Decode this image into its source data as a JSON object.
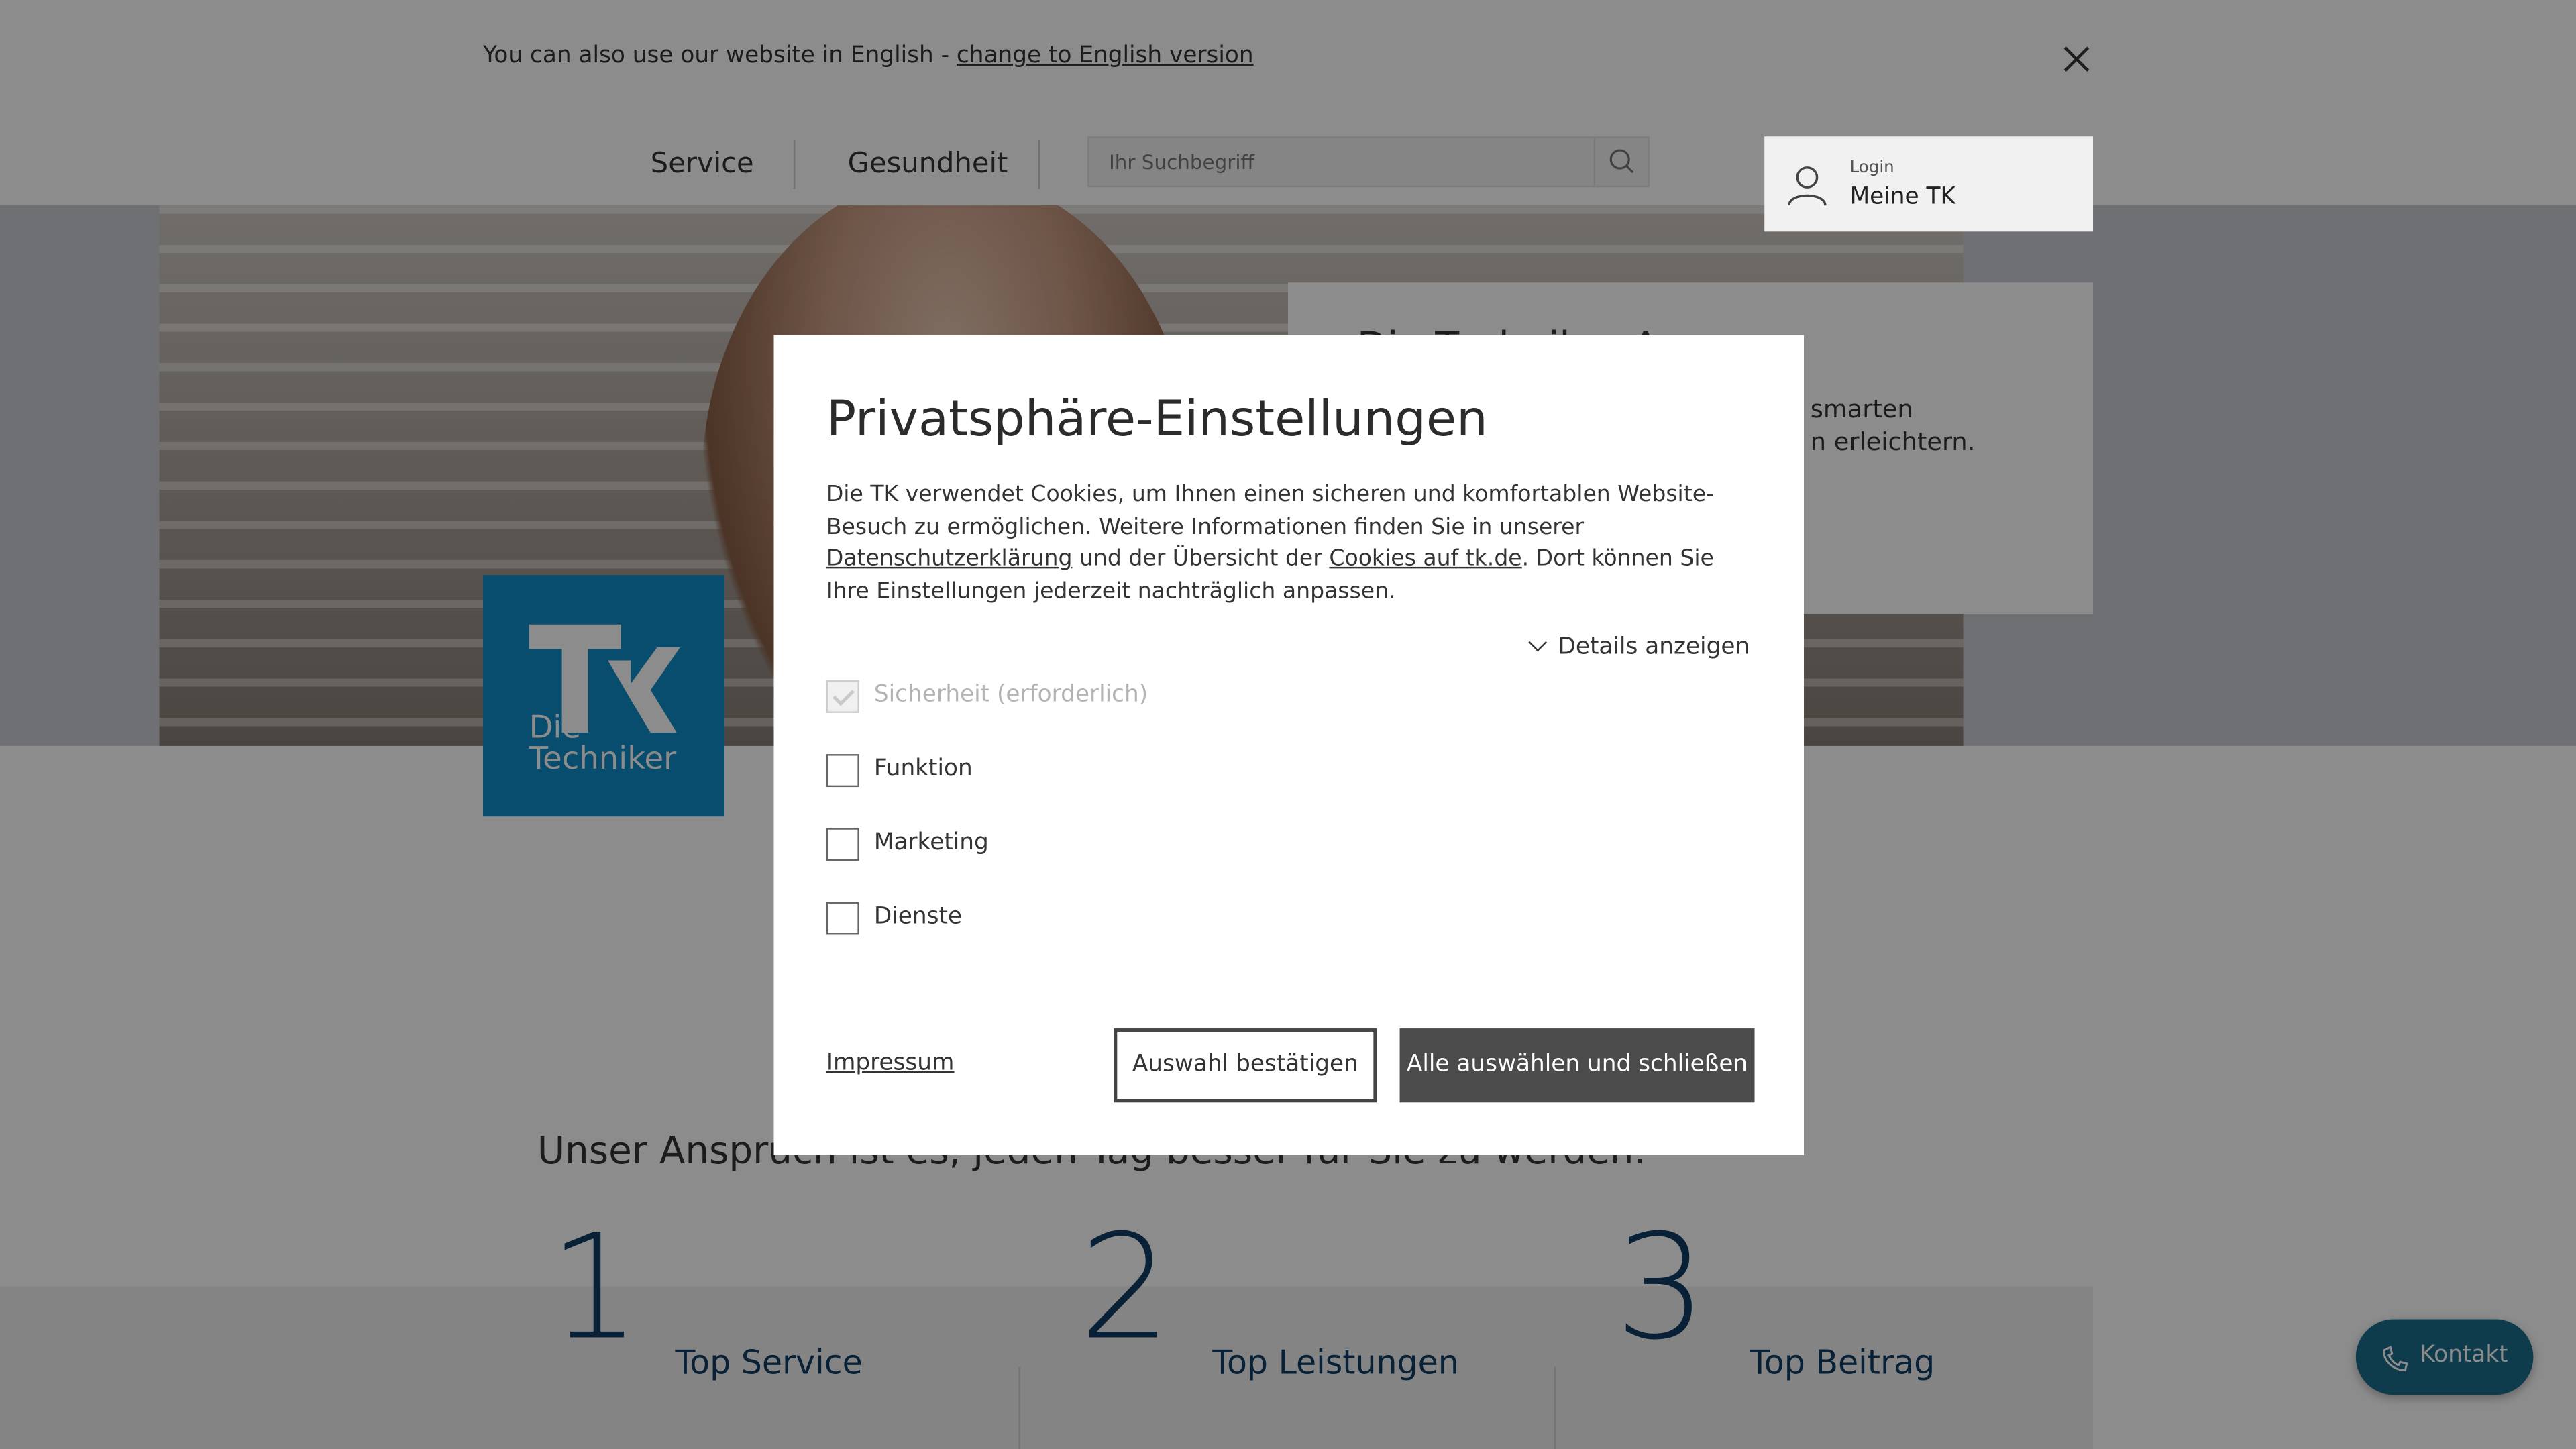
{
  "language_bar": {
    "text": "You can also use our website in English - ",
    "link": "change to English version"
  },
  "nav": {
    "items": [
      "Service",
      "Gesundheit"
    ],
    "search_placeholder": "Ihr Suchbegriff",
    "login_small": "Login",
    "login_big": "Meine TK"
  },
  "hero": {
    "teaser_title": "Die Techniker-App",
    "teaser_line1": "smarten",
    "teaser_line2": "n erleichtern."
  },
  "logo": {
    "line1": "Die",
    "line2": "Techniker"
  },
  "main": {
    "claim": "Unser Anspruch ist es, jeden Tag besser für Sie zu werden.",
    "pillars": [
      {
        "number": "1",
        "label": "Top Service"
      },
      {
        "number": "2",
        "label": "Top Leistungen"
      },
      {
        "number": "3",
        "label": "Top Beitrag"
      }
    ]
  },
  "kontakt": {
    "label": "Kontakt"
  },
  "dialog": {
    "title": "Privatsphäre-Einstellungen",
    "text_1": "Die TK verwendet Cookies, um Ihnen einen sicheren und komfortablen Website-Besuch zu ermöglichen. Weitere Informationen finden Sie in unserer ",
    "link_privacy": "Datenschutzerklärung",
    "text_2": " und der Übersicht der ",
    "link_cookies": "Cookies auf tk.de",
    "text_3": ". Dort können Sie Ihre Einstellungen jederzeit nachträglich anpassen.",
    "details": "Details anzeigen",
    "options": [
      {
        "label": "Sicherheit (erforderlich)",
        "checked": true,
        "disabled": true
      },
      {
        "label": "Funktion",
        "checked": false,
        "disabled": false
      },
      {
        "label": "Marketing",
        "checked": false,
        "disabled": false
      },
      {
        "label": "Dienste",
        "checked": false,
        "disabled": false
      }
    ],
    "impressum": "Impressum",
    "confirm_button": "Auswahl bestätigen",
    "accept_all_button": "Alle auswählen und schließen"
  },
  "colors": {
    "brand_blue": "#0f8ac9",
    "dark_blue": "#0f3d63",
    "kontakt": "#1a6d8a",
    "primary_button": "#4b4b4b"
  }
}
